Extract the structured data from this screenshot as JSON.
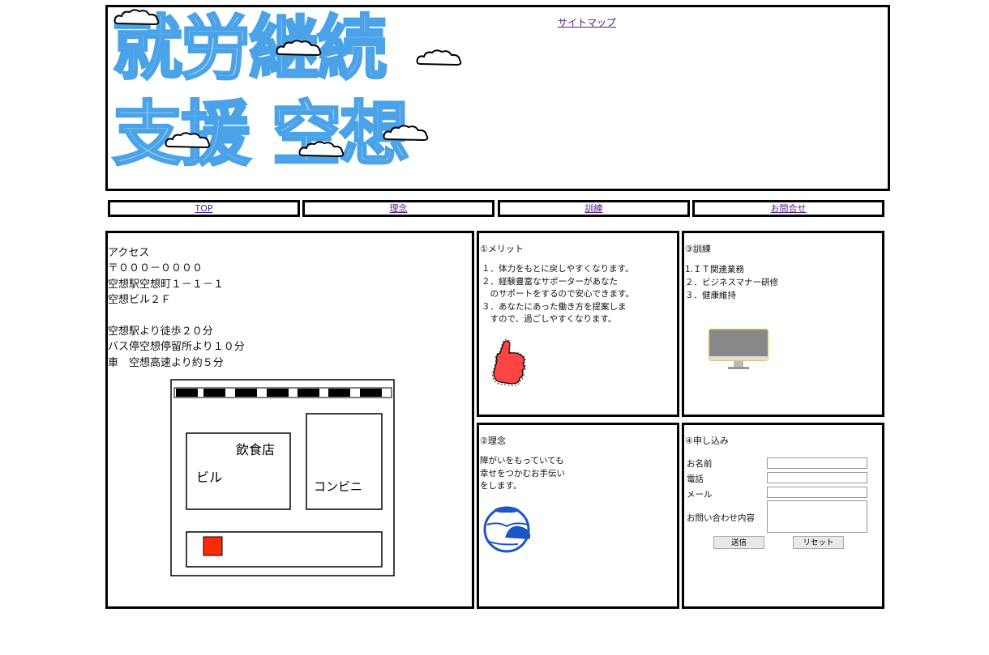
{
  "header": {
    "logo_line1": "就労継続",
    "logo_line2": "支援 空想",
    "sitemap_label": "サイトマップ"
  },
  "nav": {
    "items": [
      "TOP",
      "理念",
      "訓練",
      "お問合せ"
    ]
  },
  "access": {
    "text": "アクセス\n〒０００－００００\n空想駅空想町１－１－１\n空想ビル２Ｆ\n\n空想駅より徒歩２０分\nバス停空想停留所より１０分\n車　空想高速より約５分",
    "map": {
      "restaurant_label": "飲食店",
      "building_label": "ビル",
      "convenience_label": "コンビニ"
    }
  },
  "merit": {
    "title": "①メリット",
    "list": "１．体力をもとに戻しやすくなります。\n２．経験豊富なサポーターがあなた\n　のサポートをするので安心できます。\n３．あなたにあった働き方を提案しま\n　すので、過ごしやすくなります。"
  },
  "training": {
    "title": "③訓練",
    "list": "1.ＩＴ関連業務\n２．ビジネスマナー研修\n３．健康維持"
  },
  "idea": {
    "title": "②理念",
    "text": "障がいをもっていても\n幸せをつかむお手伝い\nをします。"
  },
  "apply": {
    "title": "④申し込み",
    "name_label": "お名前",
    "phone_label": "電話",
    "email_label": "メール",
    "message_label": "お問い合わせ内容",
    "submit_label": "送信",
    "reset_label": "リセット"
  },
  "colors": {
    "logo_pale": "#b9d8f5",
    "logo_blue": "#3b9de6",
    "logo_stroke": "#1c7fd1",
    "link": "#551a8b"
  }
}
